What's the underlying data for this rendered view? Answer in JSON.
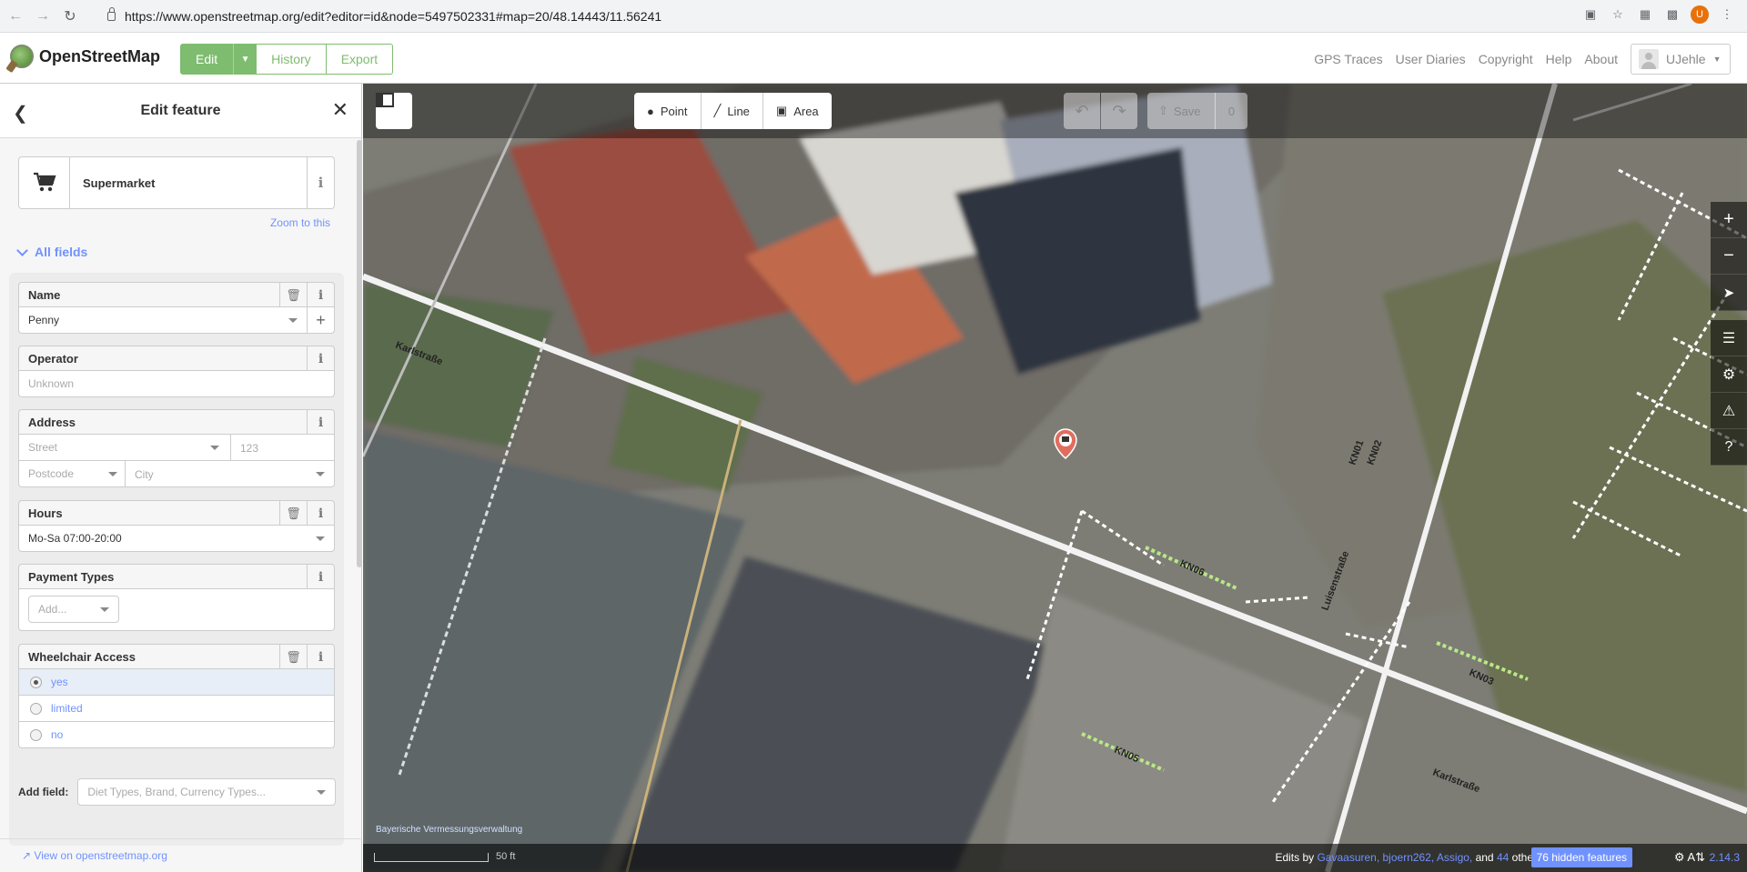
{
  "browser": {
    "url": "https://www.openstreetmap.org/edit?editor=id&node=5497502331#map=20/48.14443/11.56241",
    "profile_initial": "U"
  },
  "header": {
    "site_name": "OpenStreetMap",
    "tabs": {
      "edit": "Edit",
      "history": "History",
      "export": "Export"
    },
    "nav": [
      "GPS Traces",
      "User Diaries",
      "Copyright",
      "Help",
      "About"
    ],
    "username": "UJehle"
  },
  "sidebar": {
    "title": "Edit feature",
    "preset": {
      "name": "Supermarket",
      "info": "i"
    },
    "zoom_to": "Zoom to this",
    "all_fields": "All fields",
    "fields": {
      "name": {
        "label": "Name",
        "value": "Penny"
      },
      "operator": {
        "label": "Operator",
        "placeholder": "Unknown"
      },
      "address": {
        "label": "Address",
        "street_placeholder": "Street",
        "housenumber_placeholder": "123",
        "postcode_placeholder": "Postcode",
        "city_placeholder": "City"
      },
      "hours": {
        "label": "Hours",
        "value": "Mo-Sa 07:00-20:00"
      },
      "payment": {
        "label": "Payment Types",
        "placeholder": "Add..."
      },
      "wheelchair": {
        "label": "Wheelchair Access",
        "options": [
          "yes",
          "limited",
          "no"
        ],
        "selected": "yes"
      }
    },
    "add_field": {
      "label": "Add field:",
      "placeholder": "Diet Types, Brand, Currency Types..."
    },
    "view_on": "View on openstreetmap.org"
  },
  "map": {
    "tools": {
      "point": "Point",
      "line": "Line",
      "area": "Area"
    },
    "save": {
      "label": "Save",
      "count": "0"
    },
    "street_labels": [
      "Karlstraße",
      "Karlstraße",
      "Luisenstraße",
      "KN01",
      "KN02",
      "KN06",
      "KN03",
      "KN05"
    ],
    "attribution": "Bayerische Vermessungsverwaltung",
    "scale": "50 ft",
    "footer": {
      "edits_by_prefix": "Edits by ",
      "editors": "Gavaasuren, bjoern262, Assigo,",
      "and": " and ",
      "others_count": "44",
      "others_suffix": " others",
      "hidden_features": "76 hidden features",
      "version": "2.14.3"
    }
  },
  "colors": {
    "osm_green": "#7ebc6f",
    "link_blue": "#7092ff",
    "poi_red": "#e06e5f"
  }
}
